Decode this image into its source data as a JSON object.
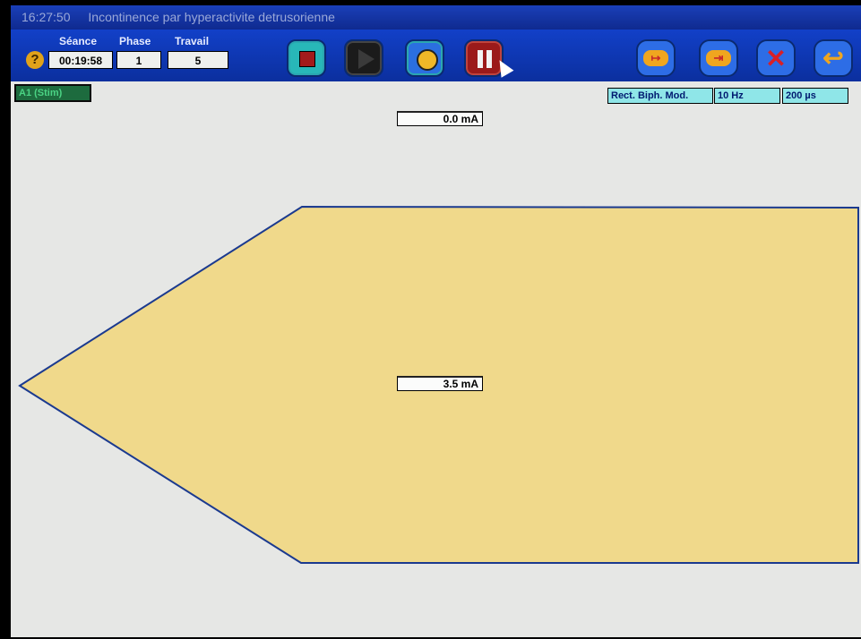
{
  "titlebar": {
    "time": "16:27:50",
    "title": "Incontinence par hyperactivite detrusorienne"
  },
  "session": {
    "help_icon": "question-icon",
    "seance_label": "Séance",
    "seance_value": "00:19:58",
    "phase_label": "Phase",
    "phase_value": "1",
    "travail_label": "Travail",
    "travail_value": "5"
  },
  "toolbar": {
    "stop_icon": "stop-icon",
    "play_icon": "play-icon",
    "timer_icon": "stopwatch-icon",
    "pause_icon": "pause-icon",
    "next_phase_icon": "next-phase-icon",
    "skip_icon": "skip-icon",
    "cancel_icon": "close-icon",
    "back_icon": "undo-icon"
  },
  "channel": {
    "label": "A1 (Stim)",
    "waveform": "Rect. Biph. Mod.",
    "frequency": "10 Hz",
    "pulse_width": "200 µs",
    "amplitude_start": "0.0 mA",
    "amplitude_plateau": "3.5 mA"
  },
  "colors": {
    "toolbar": "#1240c8",
    "workarea": "#e6e7e5",
    "envelope_fill": "#f0d98b",
    "envelope_stroke": "#1b3a8f"
  }
}
